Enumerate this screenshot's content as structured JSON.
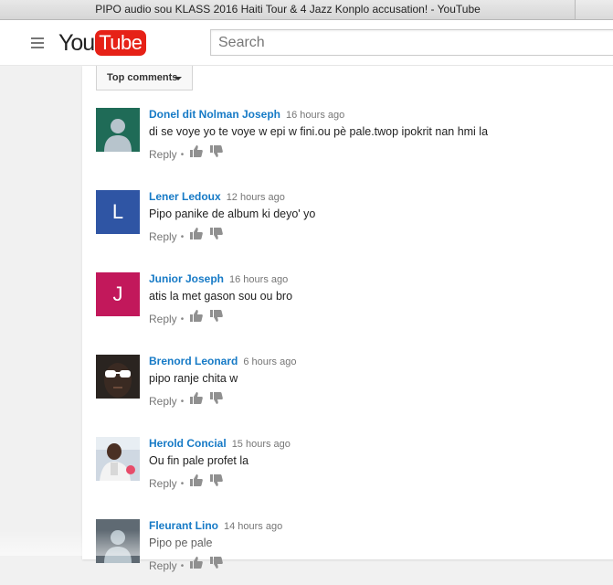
{
  "window": {
    "title": "PIPO audio sou KLASS 2016 Haiti Tour & 4 Jazz Konplo accusation! - YouTube"
  },
  "masthead": {
    "menu_icon": "hamburger-menu-icon",
    "logo_you": "You",
    "logo_tube": "Tube",
    "search_placeholder": "Search",
    "brand_color": "#e62117"
  },
  "comments_section": {
    "sort_label": "Top comments",
    "reply_label": "Reply",
    "separator": "•",
    "link_color": "#167ac6",
    "comments": [
      {
        "author": "Donel dit Nolman Joseph",
        "time": "16 hours ago",
        "text": "di se voye yo te voye w  epi w fini.ou pè pale.twop ipokrit nan hmi la",
        "avatar_type": "default-silhouette",
        "avatar_color": "#1f6b57"
      },
      {
        "author": "Lener Ledoux",
        "time": "12 hours ago",
        "text": "Pipo panike de album ki deyo' yo",
        "avatar_type": "letter",
        "avatar_letter": "L",
        "avatar_color": "#2f55a4"
      },
      {
        "author": "Junior Joseph",
        "time": "16 hours ago",
        "text": "atis la met gason sou ou bro",
        "avatar_type": "letter",
        "avatar_letter": "J",
        "avatar_color": "#c2185b"
      },
      {
        "author": "Brenord Leonard",
        "time": "6 hours ago",
        "text": "pipo ranje chita w",
        "avatar_type": "photo",
        "avatar_color": "#2a2420"
      },
      {
        "author": "Herold Concial",
        "time": "15 hours ago",
        "text": "Ou fin pale profet la",
        "avatar_type": "photo",
        "avatar_color": "#cfd8e2"
      },
      {
        "author": "Fleurant Lino",
        "time": "14 hours ago",
        "text": "Pipo pe pale",
        "avatar_type": "default-silhouette",
        "avatar_color": "#5f6a73"
      }
    ]
  }
}
